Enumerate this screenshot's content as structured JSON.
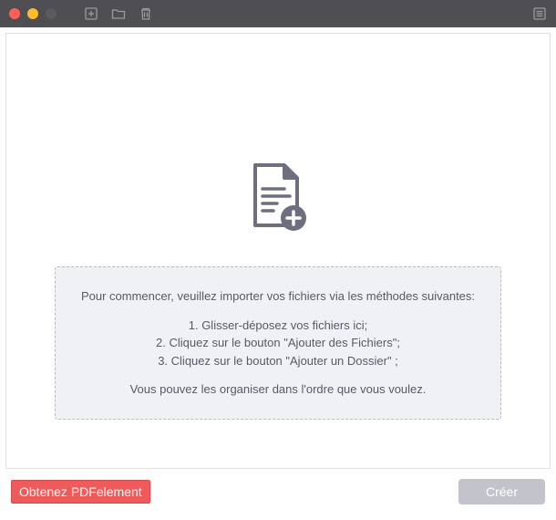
{
  "instructions": {
    "intro": "Pour commencer, veuillez importer vos fichiers via les méthodes suivantes:",
    "steps": [
      "1. Glisser-déposez vos fichiers ici;",
      "2. Cliquez sur le bouton \"Ajouter des Fichiers\";",
      "3. Cliquez sur le bouton \"Ajouter un Dossier\" ;"
    ],
    "outro": "Vous pouvez les organiser dans l'ordre que vous voulez."
  },
  "footer": {
    "get_label": "Obtenez PDFelement",
    "create_label": "Créer"
  }
}
